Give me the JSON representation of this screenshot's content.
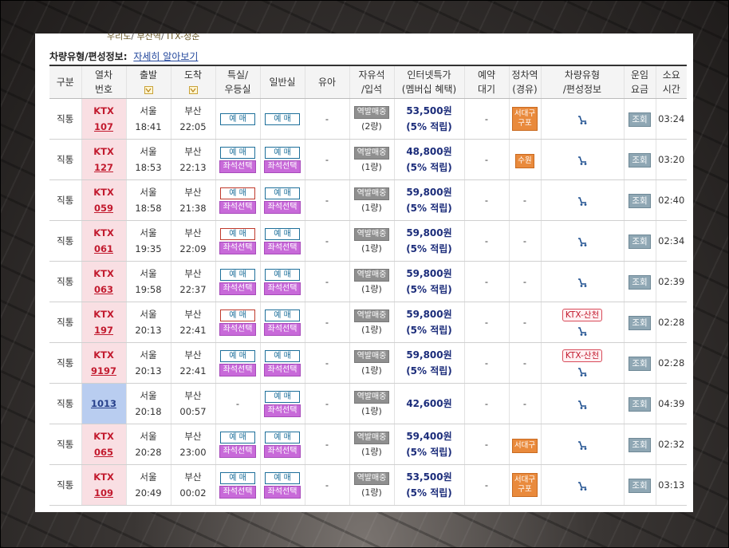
{
  "breadcrumb": [
    "우리도",
    "부산역",
    "ITX-청춘"
  ],
  "info": {
    "label": "차량유형/편성정보:",
    "link": "자세히 알아보기"
  },
  "headers": [
    "구분",
    "열차\n번호",
    "출발",
    "도착",
    "특실/\n우등실",
    "일반실",
    "유아",
    "자유석\n/입석",
    "인터넷특가\n(멤버십 혜택)",
    "예약\n대기",
    "정차역\n(경유)",
    "차량유형\n/편성정보",
    "운임\n요금",
    "소요\n시간"
  ],
  "labels": {
    "reserve": "예 매",
    "seat_select": "좌석선택",
    "station_sale": "역발매중",
    "view": "조회",
    "dash": "-"
  },
  "rows": [
    {
      "kind": "직통",
      "type": "KTX",
      "number": "107",
      "dep_st": "서울",
      "dep": "18:41",
      "arr_st": "부산",
      "arr": "22:05",
      "special": "res",
      "special_seat": false,
      "general_seat": false,
      "special_red": false,
      "qty": "(2량)",
      "price": "53,500원",
      "benefit": "(5% 적립)",
      "stop": "서대구\n구포",
      "link": "",
      "duration": "03:24"
    },
    {
      "kind": "직통",
      "type": "KTX",
      "number": "127",
      "dep_st": "서울",
      "dep": "18:53",
      "arr_st": "부산",
      "arr": "22:13",
      "special": "res",
      "special_seat": true,
      "general_seat": true,
      "special_red": false,
      "qty": "(1량)",
      "price": "48,800원",
      "benefit": "(5% 적립)",
      "stop": "수원",
      "link": "",
      "duration": "03:20"
    },
    {
      "kind": "직통",
      "type": "KTX",
      "number": "059",
      "dep_st": "서울",
      "dep": "18:58",
      "arr_st": "부산",
      "arr": "21:38",
      "special": "res",
      "special_seat": true,
      "general_seat": true,
      "special_red": true,
      "qty": "(1량)",
      "price": "59,800원",
      "benefit": "(5% 적립)",
      "stop": "",
      "link": "",
      "duration": "02:40"
    },
    {
      "kind": "직통",
      "type": "KTX",
      "number": "061",
      "dep_st": "서울",
      "dep": "19:35",
      "arr_st": "부산",
      "arr": "22:09",
      "special": "res",
      "special_seat": true,
      "general_seat": true,
      "special_red": true,
      "qty": "(1량)",
      "price": "59,800원",
      "benefit": "(5% 적립)",
      "stop": "",
      "link": "",
      "duration": "02:34"
    },
    {
      "kind": "직통",
      "type": "KTX",
      "number": "063",
      "dep_st": "서울",
      "dep": "19:58",
      "arr_st": "부산",
      "arr": "22:37",
      "special": "res",
      "special_seat": true,
      "general_seat": true,
      "special_red": false,
      "qty": "(1량)",
      "price": "59,800원",
      "benefit": "(5% 적립)",
      "stop": "",
      "link": "",
      "duration": "02:39"
    },
    {
      "kind": "직통",
      "type": "KTX",
      "number": "197",
      "dep_st": "서울",
      "dep": "20:13",
      "arr_st": "부산",
      "arr": "22:41",
      "special": "res",
      "special_seat": true,
      "general_seat": true,
      "special_red": true,
      "qty": "(1량)",
      "price": "59,800원",
      "benefit": "(5% 적립)",
      "stop": "",
      "link": "KTX-산천",
      "duration": "02:28"
    },
    {
      "kind": "직통",
      "type": "KTX",
      "number": "9197",
      "dep_st": "서울",
      "dep": "20:13",
      "arr_st": "부산",
      "arr": "22:41",
      "special": "res",
      "special_seat": true,
      "general_seat": true,
      "special_red": false,
      "qty": "(1량)",
      "price": "59,800원",
      "benefit": "(5% 적립)",
      "stop": "",
      "link": "KTX-산천",
      "duration": "02:28"
    },
    {
      "kind": "직통",
      "type": "",
      "number": "1013",
      "dep_st": "서울",
      "dep": "20:18",
      "arr_st": "부산",
      "arr": "00:57",
      "special": "none",
      "special_seat": false,
      "general_seat": true,
      "special_red": false,
      "qty": "(1량)",
      "price": "42,600원",
      "benefit": "",
      "stop": "",
      "link": "",
      "duration": "04:39"
    },
    {
      "kind": "직통",
      "type": "KTX",
      "number": "065",
      "dep_st": "서울",
      "dep": "20:28",
      "arr_st": "부산",
      "arr": "23:00",
      "special": "res",
      "special_seat": true,
      "general_seat": true,
      "special_red": false,
      "qty": "(1량)",
      "price": "59,400원",
      "benefit": "(5% 적립)",
      "stop": "서대구",
      "link": "",
      "duration": "02:32"
    },
    {
      "kind": "직통",
      "type": "KTX",
      "number": "109",
      "dep_st": "서울",
      "dep": "20:49",
      "arr_st": "부산",
      "arr": "00:02",
      "special": "res",
      "special_seat": true,
      "general_seat": true,
      "special_red": false,
      "qty": "(1량)",
      "price": "53,500원",
      "benefit": "(5% 적립)",
      "stop": "서대구\n구포",
      "link": "",
      "duration": "03:13"
    }
  ],
  "colors": {
    "ktx_bg": "#f9dfe3",
    "general_bg": "#b9cdf0",
    "seat_btn": "#c86ad9",
    "stop_badge": "#e98a3c",
    "price": "#1b2c7a"
  },
  "icons": {
    "car": "train-car-icon",
    "dropdown": "sort-dropdown-icon"
  }
}
